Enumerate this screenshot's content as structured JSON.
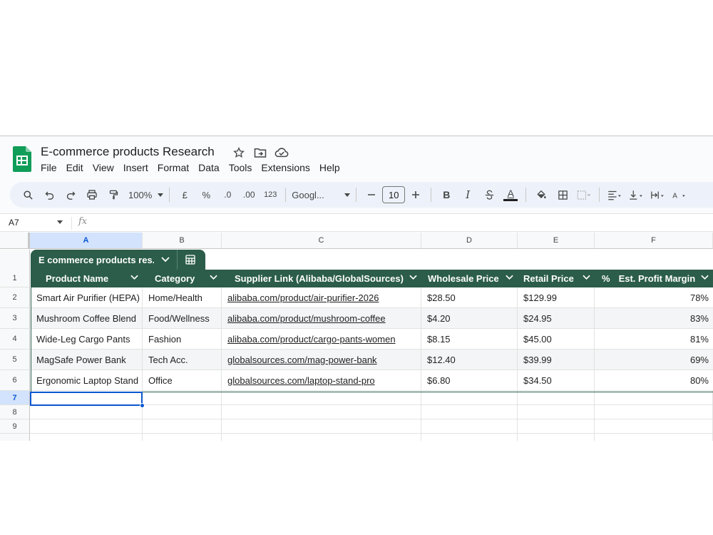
{
  "app": {
    "title": "E-commerce products Research",
    "brand_color": "#0f9d58",
    "accent_color": "#0b57d0",
    "table_header_color": "#2b5d4a"
  },
  "menu": [
    "File",
    "Edit",
    "View",
    "Insert",
    "Format",
    "Data",
    "Tools",
    "Extensions",
    "Help"
  ],
  "toolbar": {
    "zoom": "100%",
    "currency": "£",
    "percent": "%",
    "decrease_decimal": ".0",
    "increase_decimal": ".00",
    "number_format": "123",
    "font": "Googl...",
    "font_size": "10",
    "bold": "B",
    "italic": "I",
    "text_color": "A"
  },
  "formula_bar": {
    "cell_ref": "A7",
    "fx": "fx",
    "value": ""
  },
  "columns": [
    "A",
    "B",
    "C",
    "D",
    "E",
    "F"
  ],
  "rows": [
    "1",
    "2",
    "3",
    "4",
    "5",
    "6",
    "7",
    "8",
    "9"
  ],
  "table": {
    "name": "E commerce products res...",
    "headers": [
      "Product Name",
      "Category",
      "Supplier Link (Alibaba/GlobalSources)",
      "Wholesale Price",
      "Retail Price",
      "Est. Profit Margin"
    ],
    "percent_header_icon": "%",
    "rows": [
      [
        "Smart Air Purifier (HEPA)",
        "Home/Health",
        "alibaba.com/product/air-purifier-2026",
        "$28.50",
        "$129.99",
        "78%"
      ],
      [
        "Mushroom Coffee Blend",
        "Food/Wellness",
        "alibaba.com/product/mushroom-coffee",
        "$4.20",
        "$24.95",
        "83%"
      ],
      [
        "Wide-Leg Cargo Pants",
        "Fashion",
        "alibaba.com/product/cargo-pants-women",
        "$8.15",
        "$45.00",
        "81%"
      ],
      [
        "MagSafe Power Bank",
        "Tech Acc.",
        "globalsources.com/mag-power-bank",
        "$12.40",
        "$39.99",
        "69%"
      ],
      [
        "Ergonomic Laptop Stand",
        "Office",
        "globalsources.com/laptop-stand-pro",
        "$6.80",
        "$34.50",
        "80%"
      ]
    ]
  }
}
